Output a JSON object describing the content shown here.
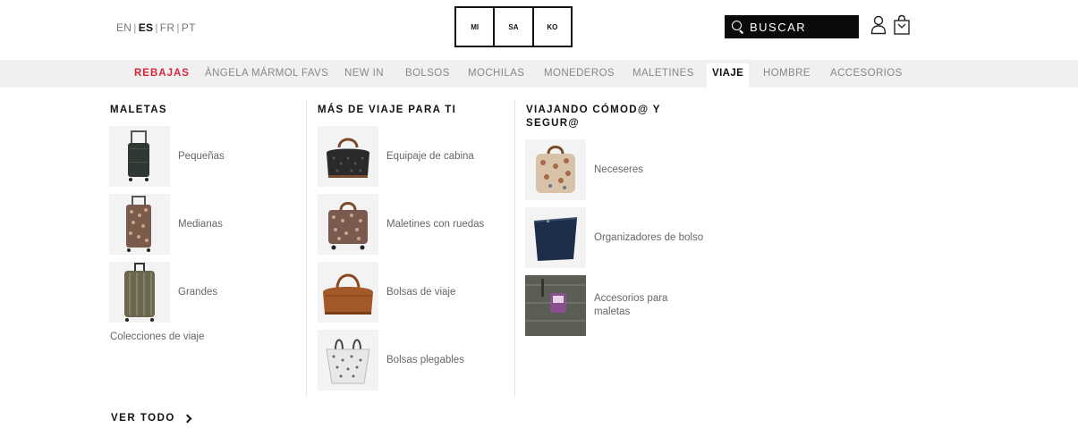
{
  "lang": {
    "items": [
      "EN",
      "ES",
      "FR",
      "PT"
    ],
    "active": "ES"
  },
  "logo": {
    "cells": [
      "MI",
      "SA",
      "KO"
    ]
  },
  "search": {
    "label": "BUSCAR",
    "icon": "search-icon"
  },
  "header_icons": {
    "user": "user-icon",
    "bag": "shopping-bag-icon"
  },
  "nav": {
    "items": [
      "REBAJAS",
      "ÀNGELA MÁRMOL FAVS",
      "NEW IN",
      "BOLSOS",
      "MOCHILAS",
      "MONEDEROS",
      "MALETINES",
      "VIAJE",
      "HOMBRE",
      "ACCESORIOS"
    ],
    "active": "VIAJE",
    "sale_color": "#d6283a"
  },
  "menu": {
    "col1": {
      "title": "MALETAS",
      "items": [
        "Pequeñas",
        "Medianas",
        "Grandes"
      ],
      "extra": "Colecciones de viaje"
    },
    "col2": {
      "title": "MÁS DE VIAJE PARA TI",
      "items": [
        "Equipaje de cabina",
        "Maletines con ruedas",
        "Bolsas de viaje",
        "Bolsas plegables"
      ]
    },
    "col3": {
      "title_line1": "VIAJANDO CÓMOD@ Y",
      "title_line2": "SEGUR@",
      "items": [
        "Neceseres",
        "Organizadores de bolso"
      ],
      "item3_line1": "Accesorios para",
      "item3_line2": "maletas"
    }
  },
  "ver_todo": "VER TODO"
}
